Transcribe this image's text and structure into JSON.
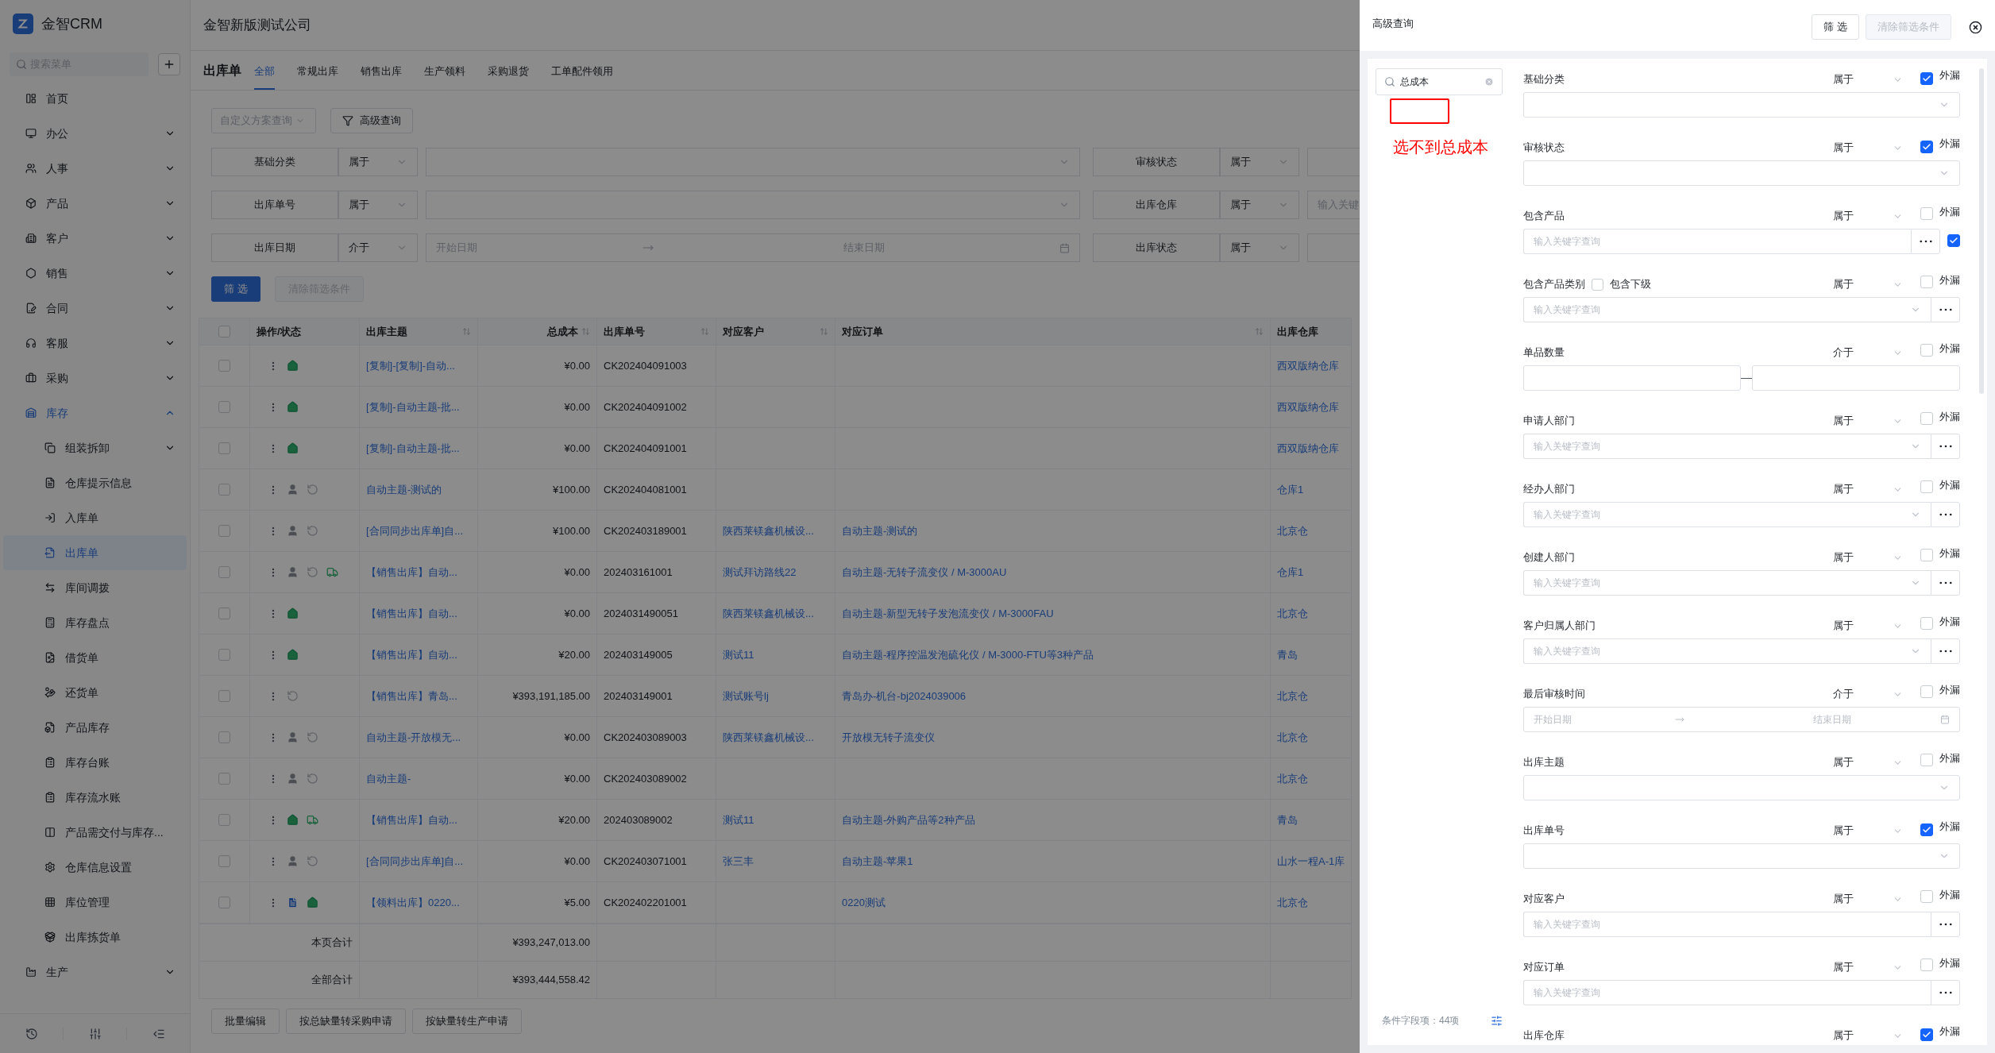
{
  "app": {
    "logo_text": "金智CRM",
    "search_placeholder": "搜索菜单"
  },
  "sidebar": {
    "items": [
      {
        "label": "首页",
        "selected": false
      },
      {
        "label": "办公",
        "selected": false,
        "expanded": false
      },
      {
        "label": "人事",
        "selected": false,
        "expanded": false
      },
      {
        "label": "产品",
        "selected": false,
        "expanded": false
      },
      {
        "label": "客户",
        "selected": false,
        "expanded": false
      },
      {
        "label": "销售",
        "selected": false,
        "expanded": false
      },
      {
        "label": "合同",
        "selected": false,
        "expanded": false
      },
      {
        "label": "客服",
        "selected": false,
        "expanded": false
      },
      {
        "label": "采购",
        "selected": false,
        "expanded": false
      },
      {
        "label": "库存",
        "selected": true,
        "expanded": true,
        "children": [
          {
            "label": "组装拆卸",
            "selected": false,
            "expanded": false
          },
          {
            "label": "仓库提示信息",
            "selected": false
          },
          {
            "label": "入库单",
            "selected": false
          },
          {
            "label": "出库单",
            "selected": true
          },
          {
            "label": "库间调拨",
            "selected": false
          },
          {
            "label": "库存盘点",
            "selected": false
          },
          {
            "label": "借货单",
            "selected": false
          },
          {
            "label": "还货单",
            "selected": false
          },
          {
            "label": "产品库存",
            "selected": false
          },
          {
            "label": "库存台账",
            "selected": false
          },
          {
            "label": "库存流水账",
            "selected": false
          },
          {
            "label": "产品需交付与库存...",
            "selected": false
          },
          {
            "label": "仓库信息设置",
            "selected": false
          },
          {
            "label": "库位管理",
            "selected": false
          },
          {
            "label": "出库拣货单",
            "selected": false
          }
        ]
      },
      {
        "label": "生产",
        "selected": false,
        "expanded": false
      }
    ]
  },
  "header": {
    "company": "金智新版测试公司"
  },
  "page_tabs": {
    "title": "出库单",
    "tabs": [
      {
        "label": "全部",
        "selected": true
      },
      {
        "label": "常规出库",
        "selected": false
      },
      {
        "label": "销售出库",
        "selected": false
      },
      {
        "label": "生产领料",
        "selected": false
      },
      {
        "label": "采购退货",
        "selected": false
      },
      {
        "label": "工单配件领用",
        "selected": false
      }
    ]
  },
  "filters": {
    "scheme_placeholder": "自定义方案查询",
    "advanced_button": "高级查询",
    "rows": [
      {
        "left": {
          "label": "基础分类",
          "operator": "属于",
          "kind": "select"
        },
        "right": {
          "label": "审核状态",
          "operator": "属于"
        }
      },
      {
        "left": {
          "label": "出库单号",
          "operator": "属于",
          "kind": "select"
        },
        "right": {
          "label": "出库仓库",
          "operator": "属于",
          "placeholder": "输入关键"
        }
      },
      {
        "left": {
          "label": "出库日期",
          "operator": "介于",
          "kind": "date",
          "start": "开始日期",
          "end": "结束日期"
        },
        "right": {
          "label": "出库状态",
          "operator": "属于"
        }
      }
    ],
    "submit": "筛 选",
    "clear": "清除筛选条件",
    "clear_disabled": true
  },
  "table": {
    "select_all_checked": false,
    "columns": [
      {
        "label": "操作/状态",
        "sortable": false
      },
      {
        "label": "出库主题",
        "sortable": true
      },
      {
        "label": "总成本",
        "sortable": true
      },
      {
        "label": "出库单号",
        "sortable": true
      },
      {
        "label": "对应客户",
        "sortable": true
      },
      {
        "label": "对应订单",
        "sortable": true
      },
      {
        "label": "出库仓库",
        "sortable": false
      }
    ],
    "rows": [
      {
        "checked": false,
        "statuses": [
          {
            "kind": "stocked"
          }
        ],
        "subject": "[复制]-[复制]-自动...",
        "cost": "¥0.00",
        "number": "CK202404091003",
        "customer": "",
        "order": "",
        "warehouse": "西双版纳仓库"
      },
      {
        "checked": false,
        "statuses": [
          {
            "kind": "stocked"
          }
        ],
        "subject": "[复制]-自动主题-批...",
        "cost": "¥0.00",
        "number": "CK202404091002",
        "customer": "",
        "order": "",
        "warehouse": "西双版纳仓库"
      },
      {
        "checked": false,
        "statuses": [
          {
            "kind": "stocked"
          }
        ],
        "subject": "[复制]-自动主题-批...",
        "cost": "¥0.00",
        "number": "CK202404091001",
        "customer": "",
        "order": "",
        "warehouse": "西双版纳仓库"
      },
      {
        "checked": false,
        "statuses": [
          {
            "kind": "user"
          },
          {
            "kind": "waiting"
          }
        ],
        "subject": "自动主题-测试的",
        "cost": "¥100.00",
        "number": "CK202404081001",
        "customer": "",
        "order": "",
        "warehouse": "仓库1"
      },
      {
        "checked": false,
        "statuses": [
          {
            "kind": "user"
          },
          {
            "kind": "waiting"
          }
        ],
        "subject": "[合同同步出库单]自...",
        "cost": "¥100.00",
        "number": "CK202403189001",
        "customer": "陕西莱镁鑫机械设...",
        "order": "自动主题-测试的",
        "warehouse": "北京仓"
      },
      {
        "checked": false,
        "statuses": [
          {
            "kind": "user"
          },
          {
            "kind": "waiting"
          },
          {
            "kind": "delivery"
          }
        ],
        "subject": "【销售出库】自动...",
        "cost": "¥0.00",
        "number": "202403161001",
        "customer": "测试拜访路线22",
        "order": "自动主题-无转子流变仪 / M-3000AU",
        "warehouse": "仓库1"
      },
      {
        "checked": false,
        "statuses": [
          {
            "kind": "stocked"
          }
        ],
        "subject": "【销售出库】自动...",
        "cost": "¥0.00",
        "number": "2024031490051",
        "customer": "陕西莱镁鑫机械设...",
        "order": "自动主题-新型无转子发泡流变仪 / M-3000FAU",
        "warehouse": "北京仓"
      },
      {
        "checked": false,
        "statuses": [
          {
            "kind": "stocked"
          }
        ],
        "subject": "【销售出库】自动...",
        "cost": "¥20.00",
        "number": "202403149005",
        "customer": "测试11",
        "order": "自动主题-程序控温发泡硫化仪 / M-3000-FTU等3种产品",
        "warehouse": "青岛"
      },
      {
        "checked": false,
        "statuses": [
          {
            "kind": "waiting"
          }
        ],
        "subject": "【销售出库】青岛...",
        "cost": "¥393,191,185.00",
        "number": "202403149001",
        "customer": "测试账号lj",
        "order": "青岛办-机台-bj2024039006",
        "warehouse": "北京仓"
      },
      {
        "checked": false,
        "statuses": [
          {
            "kind": "user"
          },
          {
            "kind": "waiting"
          }
        ],
        "subject": "自动主题-开放模无...",
        "cost": "¥0.00",
        "number": "CK202403089003",
        "customer": "陕西莱镁鑫机械设...",
        "order": "开放模无转子流变仪",
        "warehouse": "北京仓"
      },
      {
        "checked": false,
        "statuses": [
          {
            "kind": "user"
          },
          {
            "kind": "waiting"
          }
        ],
        "subject": "自动主题-",
        "cost": "¥0.00",
        "number": "CK202403089002",
        "customer": "",
        "order": "",
        "warehouse": "北京仓"
      },
      {
        "checked": false,
        "statuses": [
          {
            "kind": "stocked"
          },
          {
            "kind": "delivery"
          }
        ],
        "subject": "【销售出库】自动...",
        "cost": "¥20.00",
        "number": "202403089002",
        "customer": "测试11",
        "order": "自动主题-外购产品等2种产品",
        "warehouse": "青岛"
      },
      {
        "checked": false,
        "statuses": [
          {
            "kind": "user"
          },
          {
            "kind": "waiting"
          }
        ],
        "subject": "[合同同步出库单]自...",
        "cost": "¥0.00",
        "number": "CK202403071001",
        "customer": "张三丰",
        "order": "自动主题-苹果1",
        "warehouse": "山水一程A-1库"
      },
      {
        "checked": false,
        "statuses": [
          {
            "kind": "document"
          },
          {
            "kind": "stocked"
          }
        ],
        "subject": "【领料出库】0220...",
        "cost": "¥5.00",
        "number": "CK202402201001",
        "customer": "",
        "order": "0220测试",
        "warehouse": "北京仓"
      }
    ],
    "totals": [
      {
        "label": "本页合计",
        "value": "¥393,247,013.00"
      },
      {
        "label": "全部合计",
        "value": "¥393,444,558.42"
      }
    ]
  },
  "footer_buttons": [
    "批量编辑",
    "按总缺量转采购申请",
    "按缺量转生产申请"
  ],
  "drawer": {
    "title": "高级查询",
    "submit": "筛 选",
    "clear": "清除筛选条件",
    "clear_disabled": true,
    "field_search": {
      "value": "总成本"
    },
    "annotation": {
      "text": "选不到总成本"
    },
    "field_count": "条件字段项：44项",
    "fields": [
      {
        "label": "基础分类",
        "operator": "属于",
        "leak_label": "外漏",
        "leak_checked": true,
        "input": {
          "kind": "select"
        }
      },
      {
        "label": "审核状态",
        "operator": "属于",
        "leak_label": "外漏",
        "leak_checked": true,
        "input": {
          "kind": "select"
        }
      },
      {
        "label": "包含产品",
        "operator": "属于",
        "leak_label": "外漏",
        "leak_checked": false,
        "input": {
          "kind": "keyword",
          "placeholder": "输入关键字查询",
          "dropdown": false,
          "extra_checked": true
        }
      },
      {
        "label": "包含产品类别",
        "sub_option": {
          "label": "包含下级",
          "checked": false
        },
        "operator": "属于",
        "leak_label": "外漏",
        "leak_checked": false,
        "input": {
          "kind": "keyword",
          "placeholder": "输入关键字查询",
          "dropdown": true
        }
      },
      {
        "label": "单品数量",
        "operator": "介于",
        "leak_label": "外漏",
        "leak_checked": false,
        "input": {
          "kind": "range"
        }
      },
      {
        "label": "申请人部门",
        "operator": "属于",
        "leak_label": "外漏",
        "leak_checked": false,
        "input": {
          "kind": "keyword",
          "placeholder": "输入关键字查询",
          "dropdown": true
        }
      },
      {
        "label": "经办人部门",
        "operator": "属于",
        "leak_label": "外漏",
        "leak_checked": false,
        "input": {
          "kind": "keyword",
          "placeholder": "输入关键字查询",
          "dropdown": true
        }
      },
      {
        "label": "创建人部门",
        "operator": "属于",
        "leak_label": "外漏",
        "leak_checked": false,
        "input": {
          "kind": "keyword",
          "placeholder": "输入关键字查询",
          "dropdown": true
        }
      },
      {
        "label": "客户归属人部门",
        "operator": "属于",
        "leak_label": "外漏",
        "leak_checked": false,
        "input": {
          "kind": "keyword",
          "placeholder": "输入关键字查询",
          "dropdown": true
        }
      },
      {
        "label": "最后审核时间",
        "operator": "介于",
        "leak_label": "外漏",
        "leak_checked": false,
        "input": {
          "kind": "date",
          "start": "开始日期",
          "end": "结束日期"
        }
      },
      {
        "label": "出库主题",
        "operator": "属于",
        "leak_label": "外漏",
        "leak_checked": false,
        "input": {
          "kind": "select"
        }
      },
      {
        "label": "出库单号",
        "operator": "属于",
        "leak_label": "外漏",
        "leak_checked": true,
        "input": {
          "kind": "select"
        }
      },
      {
        "label": "对应客户",
        "operator": "属于",
        "leak_label": "外漏",
        "leak_checked": false,
        "input": {
          "kind": "keyword",
          "placeholder": "输入关键字查询",
          "dropdown": false
        }
      },
      {
        "label": "对应订单",
        "operator": "属于",
        "leak_label": "外漏",
        "leak_checked": false,
        "input": {
          "kind": "keyword",
          "placeholder": "输入关键字查询",
          "dropdown": false
        }
      },
      {
        "label": "出库仓库",
        "operator": "属于",
        "leak_label": "外漏",
        "leak_checked": true
      }
    ]
  }
}
